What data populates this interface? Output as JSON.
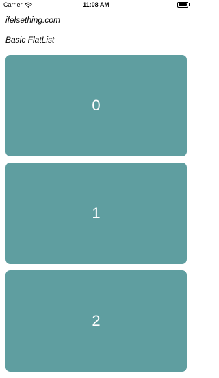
{
  "status_bar": {
    "carrier": "Carrier",
    "time": "11:08 AM",
    "wifi_icon": "wifi-icon",
    "battery_icon": "battery-icon"
  },
  "header": {
    "site": "ifelsething.com",
    "list_title": "Basic FlatList"
  },
  "list": {
    "items": [
      {
        "label": "0"
      },
      {
        "label": "1"
      },
      {
        "label": "2"
      }
    ],
    "item_color": "#5f9ea0",
    "text_color": "#ffffff"
  }
}
